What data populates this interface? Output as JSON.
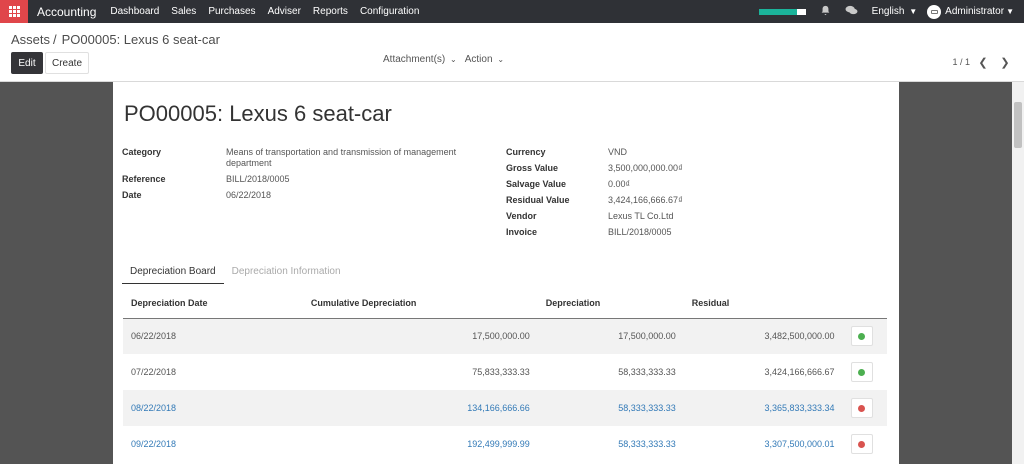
{
  "navbar": {
    "brand": "Accounting",
    "menu": [
      "Dashboard",
      "Sales",
      "Purchases",
      "Adviser",
      "Reports",
      "Configuration"
    ],
    "progress_fraction": 0.82,
    "language": "English",
    "user": "Administrator",
    "icons": {
      "apps": "apps-grid-icon",
      "bell": "bell-icon",
      "chat": "chat-icon"
    }
  },
  "control": {
    "breadcrumb_parent": "Assets",
    "breadcrumb_current": "PO00005: Lexus 6 seat-car",
    "edit_label": "Edit",
    "create_label": "Create",
    "attachments_label": "Attachment(s)",
    "action_label": "Action",
    "pager_value": "1 / 1"
  },
  "record": {
    "title": "PO00005: Lexus 6 seat-car",
    "left_fields": [
      {
        "label": "Category",
        "value": "Means of transportation and transmission of management department"
      },
      {
        "label": "Reference",
        "value": "BILL/2018/0005"
      },
      {
        "label": "Date",
        "value": "06/22/2018"
      }
    ],
    "right_fields": [
      {
        "label": "Currency",
        "value": "VND"
      },
      {
        "label": "Gross Value",
        "value": "3,500,000,000.00₫"
      },
      {
        "label": "Salvage Value",
        "value": "0.00₫"
      },
      {
        "label": "Residual Value",
        "value": "3,424,166,666.67₫"
      },
      {
        "label": "Vendor",
        "value": "Lexus TL Co.Ltd"
      },
      {
        "label": "Invoice",
        "value": "BILL/2018/0005"
      }
    ]
  },
  "tabs": [
    {
      "label": "Depreciation Board",
      "active": true
    },
    {
      "label": "Depreciation Information",
      "active": false
    }
  ],
  "board": {
    "headers": [
      "Depreciation Date",
      "Cumulative Depreciation",
      "Depreciation",
      "Residual"
    ],
    "rows": [
      {
        "date": "06/22/2018",
        "cumulative": "17,500,000.00",
        "depreciation": "17,500,000.00",
        "residual": "3,482,500,000.00",
        "status_color": "#4caf50",
        "linked": false
      },
      {
        "date": "07/22/2018",
        "cumulative": "75,833,333.33",
        "depreciation": "58,333,333.33",
        "residual": "3,424,166,666.67",
        "status_color": "#4caf50",
        "linked": false
      },
      {
        "date": "08/22/2018",
        "cumulative": "134,166,666.66",
        "depreciation": "58,333,333.33",
        "residual": "3,365,833,333.34",
        "status_color": "#d9534f",
        "linked": true
      },
      {
        "date": "09/22/2018",
        "cumulative": "192,499,999.99",
        "depreciation": "58,333,333.33",
        "residual": "3,307,500,000.01",
        "status_color": "#d9534f",
        "linked": true
      }
    ]
  }
}
